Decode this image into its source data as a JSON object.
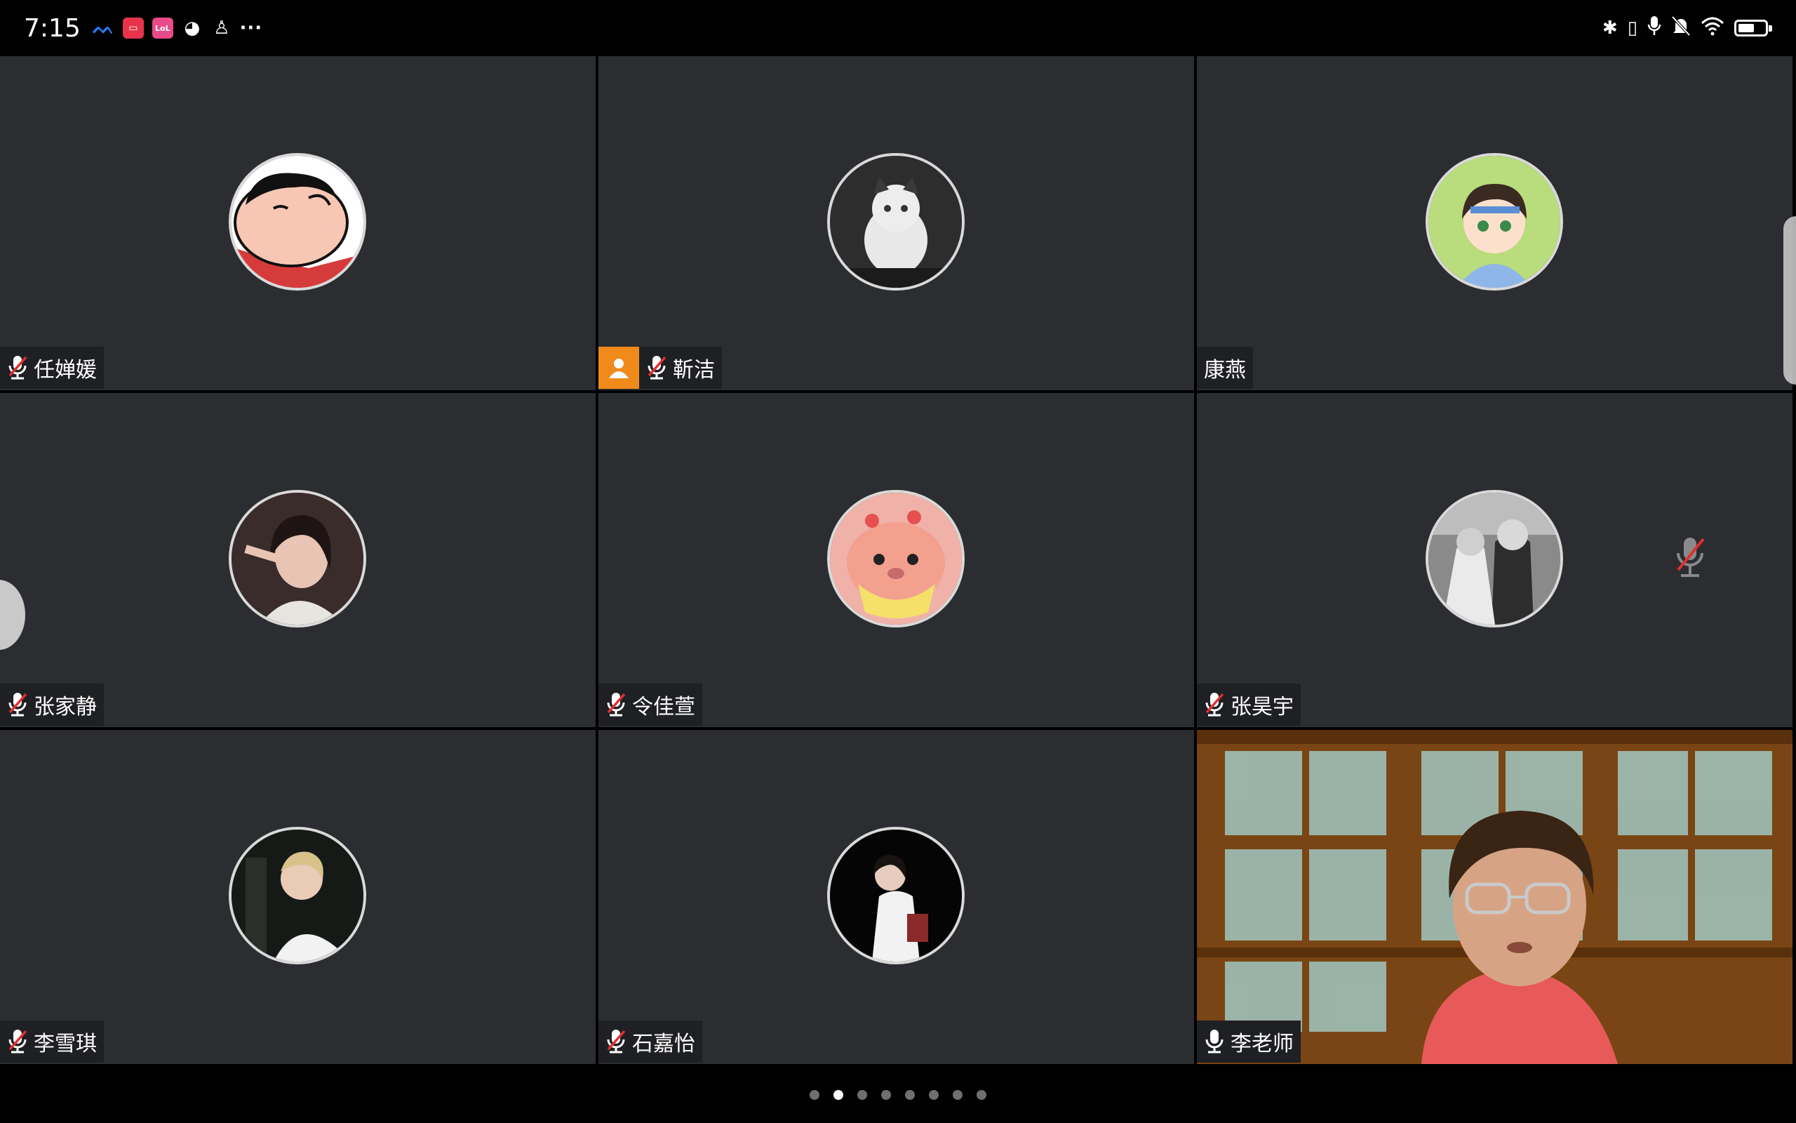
{
  "status_bar": {
    "time": "7:15",
    "apps": [
      "meeting-app-icon",
      "red-app-icon",
      "pink-app-icon",
      "wechat-icon",
      "qq-icon",
      "more-notifications-icon"
    ],
    "right_icons": [
      "bluetooth-icon",
      "vibrate-icon",
      "microphone-icon",
      "mute-icon",
      "wifi-icon",
      "battery-icon"
    ]
  },
  "participants": [
    {
      "name": "任婵媛",
      "muted": true,
      "avatar": "avatar-crayon-shin"
    },
    {
      "name": "靳洁",
      "muted": true,
      "host": true,
      "avatar": "avatar-cat"
    },
    {
      "name": "康燕",
      "muted": false,
      "avatar": "avatar-anime-boy"
    },
    {
      "name": "张家静",
      "muted": true,
      "avatar": "avatar-girl-photo"
    },
    {
      "name": "令佳萱",
      "muted": true,
      "avatar": "avatar-plush-bunny"
    },
    {
      "name": "张昊宇",
      "muted": true,
      "avatar": "avatar-bw-couple"
    },
    {
      "name": "李雪琪",
      "muted": true,
      "avatar": "avatar-girl-night"
    },
    {
      "name": "石嘉怡",
      "muted": true,
      "avatar": "avatar-girl-dark"
    },
    {
      "name": "李老师",
      "muted": false,
      "video": true,
      "avatar": "video-teacher"
    }
  ],
  "pager": {
    "total": 8,
    "current": 2
  },
  "colors": {
    "tile_bg": "#2b2d31",
    "host_badge": "#f08a1a",
    "mute_red": "#e02f2f"
  }
}
